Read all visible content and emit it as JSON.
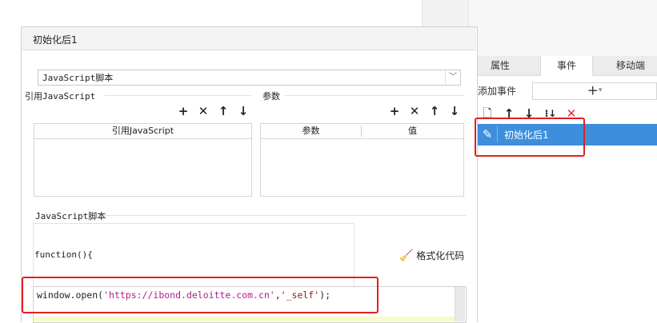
{
  "right_panel": {
    "tabs": [
      {
        "label": "属性",
        "active": false
      },
      {
        "label": "事件",
        "active": true
      },
      {
        "label": "移动端",
        "active": false
      }
    ],
    "add_event_label": "添加事件",
    "add_event_button_icon": "plus-icon",
    "event_toolbar_icons": [
      "new-file-icon",
      "arrow-up-icon",
      "arrow-down-icon",
      "sort-icon",
      "delete-icon"
    ],
    "event_item": {
      "label": "初始化后1",
      "icon": "pencil-icon",
      "selected": true
    }
  },
  "dialog": {
    "title": "初始化后1",
    "script_type_select": {
      "value": "JavaScript脚本"
    },
    "ref_js": {
      "label": "引用JavaScript",
      "column": "引用JavaScript",
      "toolbar_icons": [
        "add-icon",
        "delete-icon",
        "arrow-up-icon",
        "arrow-down-icon"
      ]
    },
    "params": {
      "label": "参数",
      "columns": [
        "参数",
        "值"
      ],
      "toolbar_icons": [
        "add-icon",
        "delete-icon",
        "arrow-up-icon",
        "arrow-down-icon"
      ]
    },
    "script_section": {
      "label": "JavaScript脚本",
      "function_header": "function(){",
      "format_button": "格式化代码",
      "code": {
        "prefix": "window.open(",
        "url": "'https://ibond.deloitte.com.cn'",
        "sep": ",",
        "target": "'_self'",
        "suffix": ");"
      }
    }
  },
  "colors": {
    "selected_item": "#3d8fdc",
    "annotation_red": "#e02020",
    "delete_red": "#e03030"
  }
}
